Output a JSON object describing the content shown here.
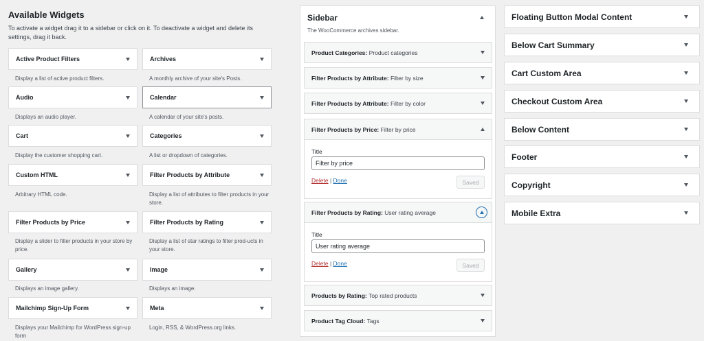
{
  "available": {
    "title": "Available Widgets",
    "description": "To activate a widget drag it to a sidebar or click on it. To deactivate a widget and delete its settings, drag it back.",
    "widgets": [
      {
        "name": "Active Product Filters",
        "desc": "Display a list of active product filters."
      },
      {
        "name": "Archives",
        "desc": "A monthly archive of your site's Posts."
      },
      {
        "name": "Audio",
        "desc": "Displays an audio player."
      },
      {
        "name": "Calendar",
        "desc": "A calendar of your site's posts."
      },
      {
        "name": "Cart",
        "desc": "Display the customer shopping cart."
      },
      {
        "name": "Categories",
        "desc": "A list or dropdown of categories."
      },
      {
        "name": "Custom HTML",
        "desc": "Arbitrary HTML code."
      },
      {
        "name": "Filter Products by Attribute",
        "desc": "Display a list of attributes to filter products in your store."
      },
      {
        "name": "Filter Products by Price",
        "desc": "Display a slider to filter products in your store by price."
      },
      {
        "name": "Filter Products by Rating",
        "desc": "Display a list of star ratings to filter prod-ucts in your store."
      },
      {
        "name": "Gallery",
        "desc": "Displays an image gallery."
      },
      {
        "name": "Image",
        "desc": "Displays an image."
      },
      {
        "name": "Mailchimp Sign-Up Form",
        "desc": "Displays your Mailchimp for WordPress sign-up form"
      },
      {
        "name": "Meta",
        "desc": "Login, RSS, & WordPress.org links."
      }
    ]
  },
  "sidebar": {
    "title": "Sidebar",
    "description": "The WooCommerce archives sidebar.",
    "widgets": [
      {
        "name": "Product Categories:",
        "sub": "Product categories"
      },
      {
        "name": "Filter Products by Attribute:",
        "sub": "Filter by size"
      },
      {
        "name": "Filter Products by Attribute:",
        "sub": "Filter by color"
      },
      {
        "name": "Filter Products by Price:",
        "sub": "Filter by price"
      },
      {
        "name": "Filter Products by Rating:",
        "sub": "User rating average"
      },
      {
        "name": "Products by Rating:",
        "sub": "Top rated products"
      },
      {
        "name": "Product Tag Cloud:",
        "sub": "Tags"
      }
    ],
    "forms": [
      {
        "title_label": "Title",
        "title_value": "Filter by price",
        "delete": "Delete",
        "separator": "|",
        "done": "Done",
        "saved": "Saved"
      },
      {
        "title_label": "Title",
        "title_value": "User rating average",
        "delete": "Delete",
        "separator": "|",
        "done": "Done",
        "saved": "Saved"
      }
    ]
  },
  "areas": [
    "Floating Button Modal Content",
    "Below Cart Summary",
    "Cart Custom Area",
    "Checkout Custom Area",
    "Below Content",
    "Footer",
    "Copyright",
    "Mobile Extra"
  ],
  "colors": {
    "background": "#f0f0f1",
    "link": "#2271b1",
    "delete": "#b32d2e"
  }
}
